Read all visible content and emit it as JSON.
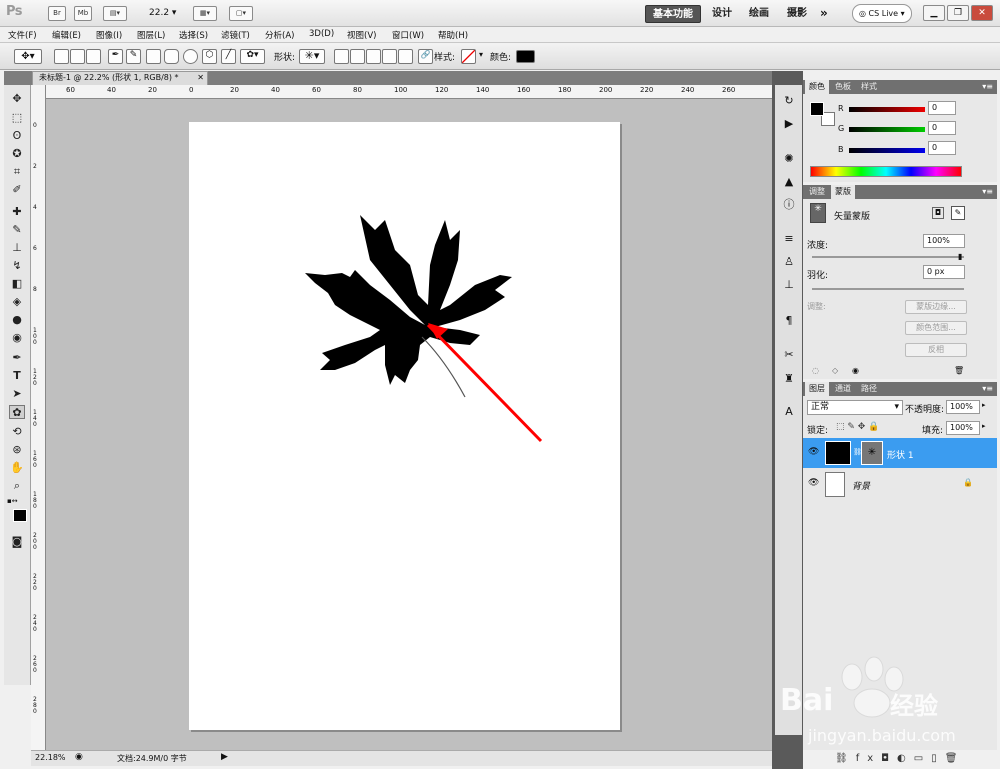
{
  "app": {
    "logo": "Ps",
    "bridge": "Br",
    "mini_bridge": "Mb",
    "zoom_value": "22.2"
  },
  "workspaces": [
    "基本功能",
    "设计",
    "绘画",
    "摄影"
  ],
  "cs_live": "CS Live",
  "menu": [
    "文件(F)",
    "编辑(E)",
    "图像(I)",
    "图层(L)",
    "选择(S)",
    "滤镜(T)",
    "分析(A)",
    "3D(D)",
    "视图(V)",
    "窗口(W)",
    "帮助(H)"
  ],
  "options": {
    "shape_label": "形状:",
    "style_label": "样式:",
    "color_label": "颜色:"
  },
  "document": {
    "tab_title": "未标题-1 @ 22.2% (形状 1, RGB/8) *"
  },
  "rulers": {
    "h": [
      "60",
      "40",
      "20",
      "0",
      "20",
      "40",
      "60",
      "80",
      "100",
      "120",
      "140",
      "160",
      "180",
      "200",
      "220",
      "240",
      "260"
    ],
    "v": [
      "0",
      "2",
      "4",
      "6",
      "8",
      "100",
      "120",
      "140",
      "160",
      "180",
      "200",
      "220",
      "240",
      "260",
      "280"
    ]
  },
  "status": {
    "zoom": "22.18%",
    "doc_info": "文档:24.9M/0 字节"
  },
  "color_panel": {
    "tabs": [
      "颜色",
      "色板",
      "样式"
    ],
    "r": "R",
    "g": "G",
    "b": "B",
    "r_val": "0",
    "g_val": "0",
    "b_val": "0"
  },
  "mask_panel": {
    "tabs": [
      "调整",
      "蒙版"
    ],
    "title": "矢量蒙版",
    "density_label": "浓度:",
    "density_val": "100%",
    "feather_label": "羽化:",
    "feather_val": "0 px",
    "adjust_label": "调整:",
    "btn_edge": "蒙版边缘...",
    "btn_range": "颜色范围...",
    "btn_invert": "反相"
  },
  "layers_panel": {
    "tabs": [
      "图层",
      "通道",
      "路径"
    ],
    "blend_mode": "正常",
    "opacity_label": "不透明度:",
    "opacity_val": "100%",
    "lock_label": "锁定:",
    "fill_label": "填充:",
    "fill_val": "100%",
    "layers": [
      {
        "name": "形状 1"
      },
      {
        "name": "背景"
      }
    ]
  },
  "watermark": {
    "brand": "Bai",
    "brand_cn": "经验",
    "url": "jingyan.baidu.com"
  },
  "colors": {
    "accent_red": "#ff0000",
    "selected_layer": "#3b9cf0"
  }
}
